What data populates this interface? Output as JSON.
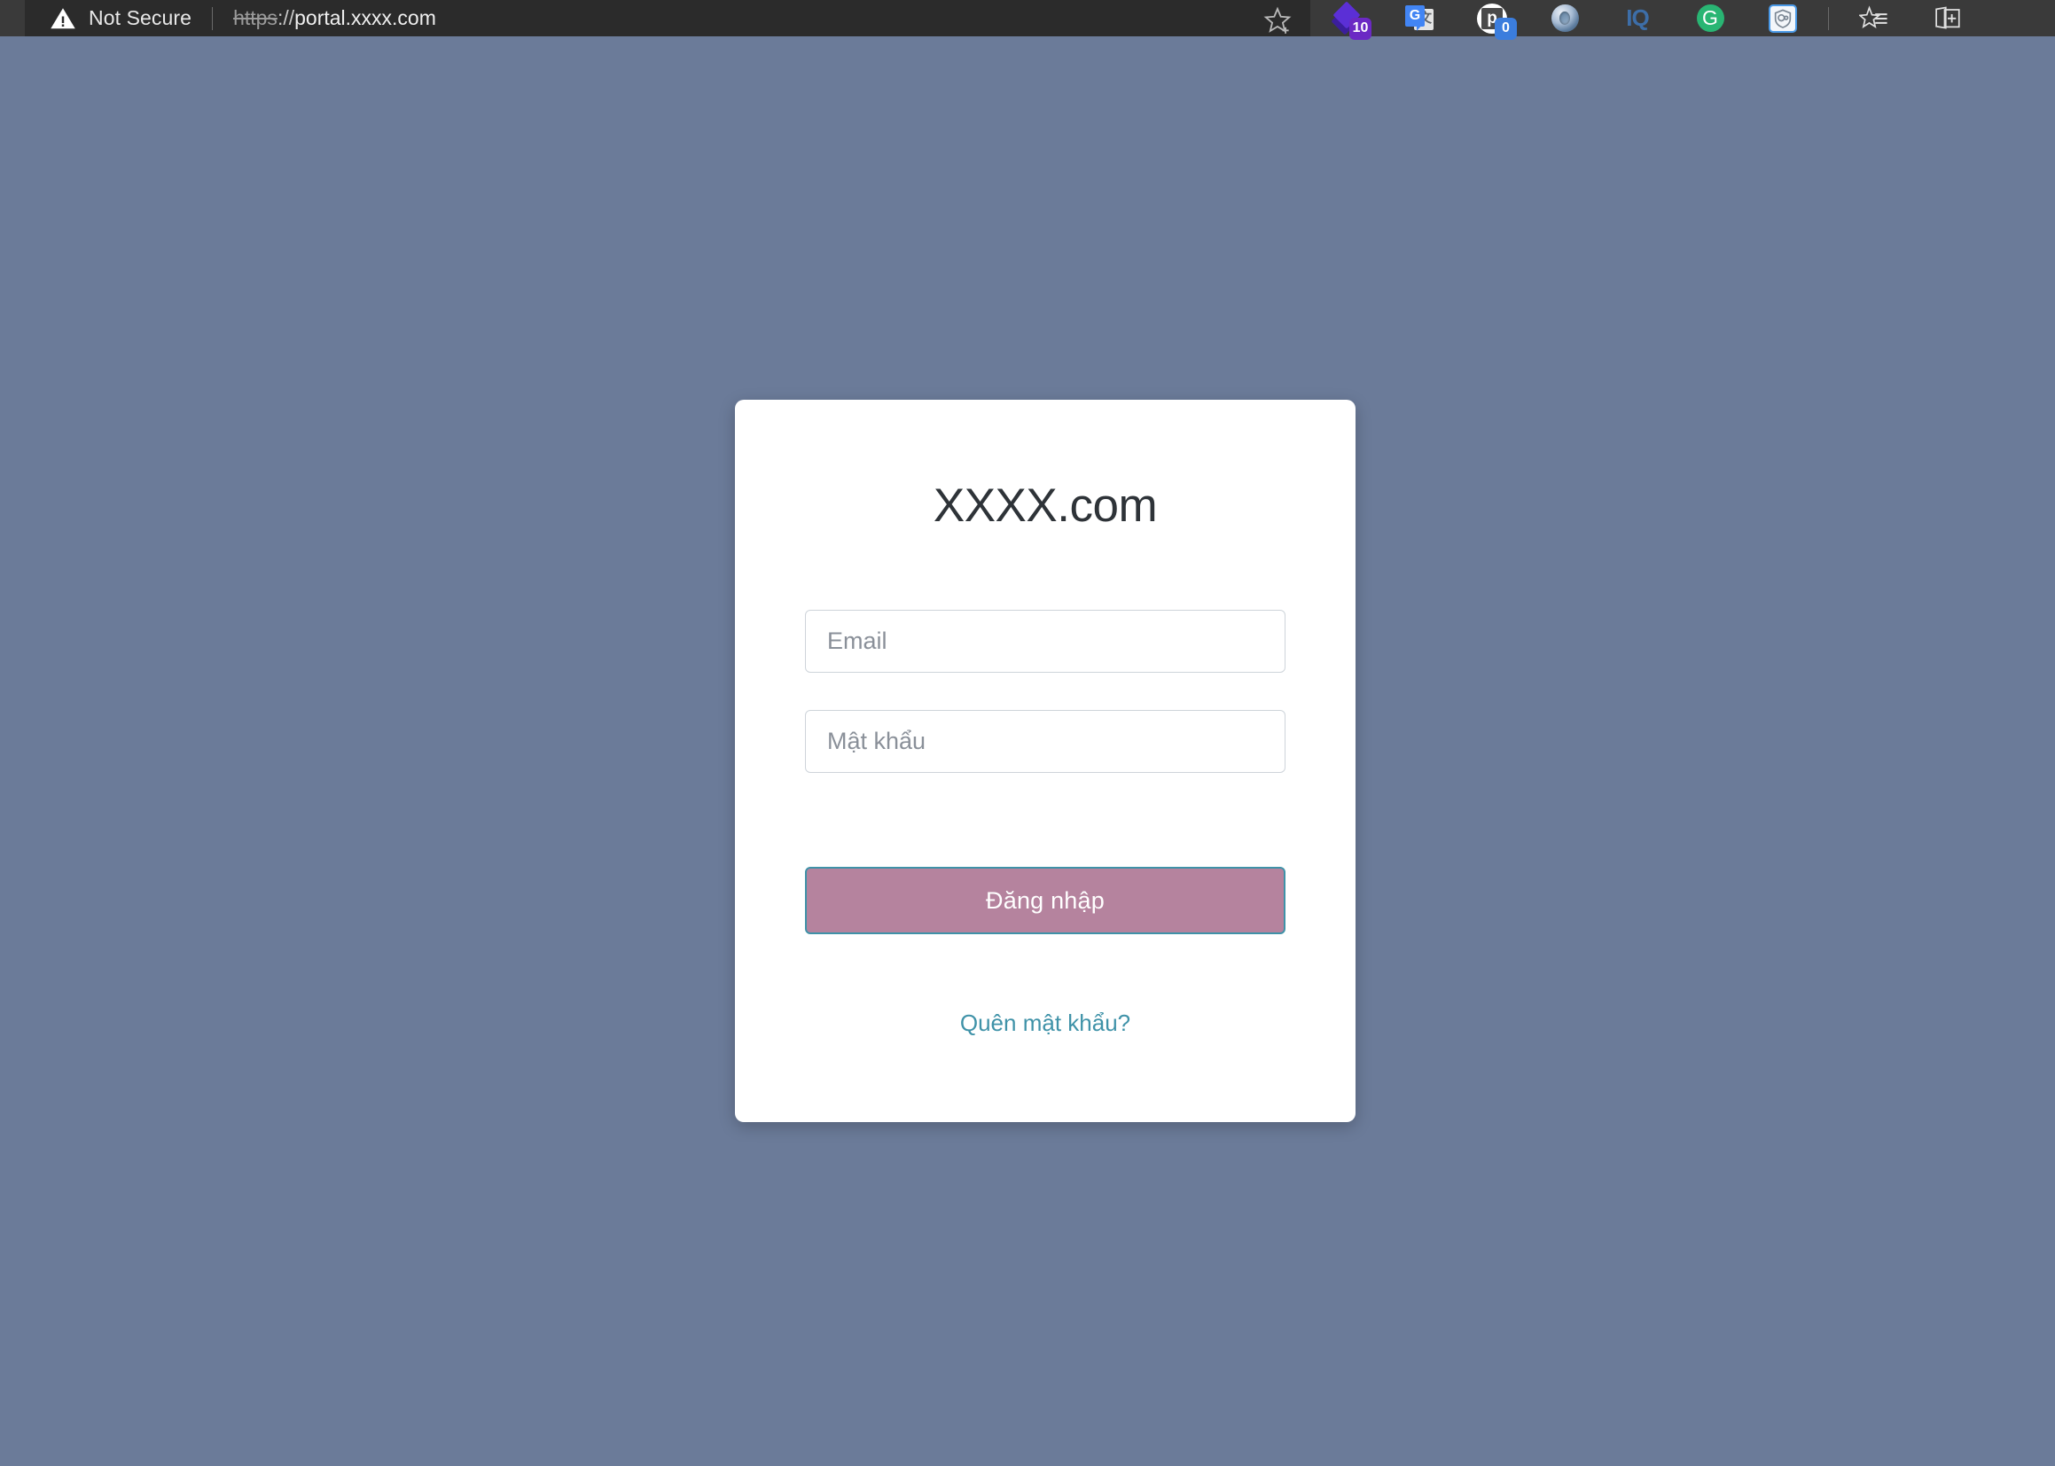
{
  "browser": {
    "security": {
      "icon": "warning-triangle-icon",
      "label": "Not Secure"
    },
    "url": {
      "scheme": "https",
      "separator": "://",
      "host": "portal.xxxx.com",
      "full": "https://portal.xxxx.com"
    },
    "bookmark_icon": "star-plus-icon",
    "extensions": [
      {
        "name": "stacked-layers-extension-icon",
        "badge": "10",
        "badge_color": "#6b29c4"
      },
      {
        "name": "google-translate-icon",
        "letter": "G",
        "glyph": "文",
        "badge": null
      },
      {
        "name": "pocket-extension-icon",
        "letter": "p",
        "badge": "0",
        "badge_color": "#3b7ddd"
      },
      {
        "name": "mendeley-ring-icon",
        "badge": null
      },
      {
        "name": "iq-extension-icon",
        "label": "IQ",
        "badge": null
      },
      {
        "name": "grammarly-icon",
        "label": "G",
        "badge": null
      },
      {
        "name": "privacy-shield-icon",
        "badge": null
      }
    ],
    "toolbar_right": [
      {
        "name": "favorites-list-icon"
      },
      {
        "name": "collections-icon"
      }
    ]
  },
  "login": {
    "title": "XXXX.com",
    "email": {
      "placeholder": "Email",
      "value": ""
    },
    "password": {
      "placeholder": "Mật khẩu",
      "value": ""
    },
    "submit_label": "Đăng nhập",
    "forgot_label": "Quên mật khẩu?"
  },
  "colors": {
    "page_background": "#6b7b99",
    "card_background": "#ffffff",
    "button_fill": "#b5839e",
    "button_border": "#3f92a8",
    "link": "#3f92a8",
    "chrome_bar": "#3a3a3a",
    "url_region": "#2b2b2b"
  }
}
